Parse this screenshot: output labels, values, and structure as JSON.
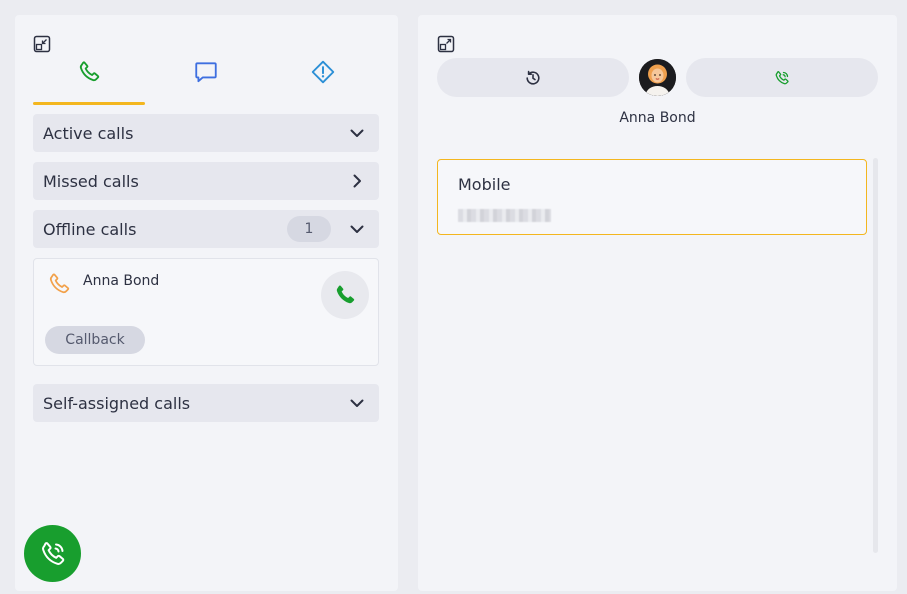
{
  "left_panel": {
    "tabs": [
      {
        "label": "Calls",
        "icon": "phone-icon",
        "color": "#189e2e",
        "active": true
      },
      {
        "label": "Chats",
        "icon": "chat-bubble-icon",
        "color": "#3e6fe0",
        "active": false
      },
      {
        "label": "Alerts",
        "icon": "warning-diamond-icon",
        "color": "#2b8fd6",
        "active": false
      }
    ],
    "sections": {
      "active_calls": "Active calls",
      "missed_calls": "Missed calls",
      "offline_calls": "Offline calls",
      "offline_count": "1",
      "self_assigned_calls": "Self-assigned calls"
    },
    "offline_call_card": {
      "name": "Anna Bond",
      "callback_label": "Callback"
    }
  },
  "right_panel": {
    "contact_name": "Anna Bond",
    "mobile_label": "Mobile",
    "mobile_number": "redacted"
  },
  "colors": {
    "accent": "#f3b61f",
    "call_green": "#189e2e",
    "offline_orange": "#f2a14a"
  }
}
